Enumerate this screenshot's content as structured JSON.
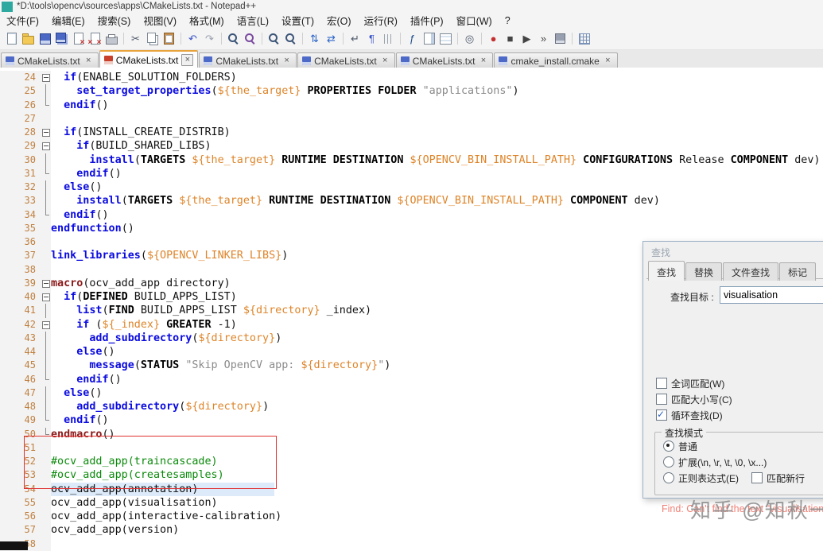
{
  "window": {
    "title": "*D:\\tools\\opencv\\sources\\apps\\CMakeLists.txt - Notepad++"
  },
  "menu": {
    "items": [
      "文件(F)",
      "编辑(E)",
      "搜索(S)",
      "视图(V)",
      "格式(M)",
      "语言(L)",
      "设置(T)",
      "宏(O)",
      "运行(R)",
      "插件(P)",
      "窗口(W)",
      "?"
    ]
  },
  "toolbar": {
    "icons": [
      {
        "n": "new-file-icon",
        "s": "page"
      },
      {
        "n": "open-file-icon",
        "s": "folder"
      },
      {
        "n": "save-icon",
        "s": "floppy"
      },
      {
        "n": "save-all-icon",
        "s": "floppy2"
      },
      {
        "n": "close-icon",
        "s": "pagex"
      },
      {
        "n": "close-all-icon",
        "s": "pagexx"
      },
      {
        "n": "print-icon",
        "s": "printer"
      },
      {
        "sep": true
      },
      {
        "n": "cut-icon",
        "s": "glyph",
        "g": "✂",
        "c": "#4A5568"
      },
      {
        "n": "copy-icon",
        "s": "pages"
      },
      {
        "n": "paste-icon",
        "s": "clipboard"
      },
      {
        "sep": true
      },
      {
        "n": "undo-icon",
        "s": "glyph",
        "g": "↶",
        "c": "#3C55C8"
      },
      {
        "n": "redo-icon",
        "s": "glyph",
        "g": "↷",
        "c": "#9AA2B0"
      },
      {
        "sep": true
      },
      {
        "n": "find-icon",
        "s": "mag"
      },
      {
        "n": "replace-icon",
        "s": "magr"
      },
      {
        "sep": true
      },
      {
        "n": "zoom-in-icon",
        "s": "mag"
      },
      {
        "n": "zoom-out-icon",
        "s": "mag"
      },
      {
        "sep": true
      },
      {
        "n": "sync-vertical-icon",
        "s": "glyph",
        "g": "⇅",
        "c": "#2A63C8"
      },
      {
        "n": "sync-horizontal-icon",
        "s": "glyph",
        "g": "⇄",
        "c": "#2A63C8"
      },
      {
        "sep": true
      },
      {
        "n": "word-wrap-icon",
        "s": "glyph",
        "g": "↵",
        "c": "#4A5568"
      },
      {
        "n": "show-all-characters-icon",
        "s": "glyph",
        "g": "¶",
        "c": "#3C55C8"
      },
      {
        "n": "indent-guide-icon",
        "s": "indent"
      },
      {
        "sep": true
      },
      {
        "n": "function-list-icon",
        "s": "glyph",
        "g": "ƒ",
        "c": "#20508C"
      },
      {
        "n": "document-map-icon",
        "s": "map"
      },
      {
        "n": "document-switcher-icon",
        "s": "switch"
      },
      {
        "sep": true
      },
      {
        "n": "file-monitoring-icon",
        "s": "glyph",
        "g": "◎",
        "c": "#4A5568"
      },
      {
        "sep": true
      },
      {
        "n": "macro-record-icon",
        "s": "glyph",
        "g": "●",
        "c": "#C43030"
      },
      {
        "n": "macro-stop-icon",
        "s": "glyph",
        "g": "■",
        "c": "#444444"
      },
      {
        "n": "macro-play-icon",
        "s": "glyph",
        "g": "▶",
        "c": "#444444"
      },
      {
        "n": "macro-run-multiple-icon",
        "s": "glyph",
        "g": "»",
        "c": "#444444"
      },
      {
        "n": "macro-save-icon",
        "s": "floppyg"
      },
      {
        "sep": true
      },
      {
        "n": "plugin-grid-icon",
        "s": "grid"
      }
    ]
  },
  "tabs": [
    {
      "label": "CMakeLists.txt",
      "modified": false,
      "active": false
    },
    {
      "label": "CMakeLists.txt",
      "modified": true,
      "active": true
    },
    {
      "label": "CMakeLists.txt",
      "modified": false,
      "active": false
    },
    {
      "label": "CMakeLists.txt",
      "modified": false,
      "active": false
    },
    {
      "label": "CMakeLists.txt",
      "modified": false,
      "active": false
    },
    {
      "label": "cmake_install.cmake",
      "modified": false,
      "active": false
    }
  ],
  "editor": {
    "first_line": 24,
    "lines": [
      {
        "n": 24,
        "f": "box",
        "s": [
          [
            "  ",
            "pl"
          ],
          [
            "if",
            "kw"
          ],
          [
            "(ENABLE_SOLUTION_FOLDERS)",
            "pl"
          ]
        ]
      },
      {
        "n": 25,
        "f": "v",
        "s": [
          [
            "    ",
            "pl"
          ],
          [
            "set_target_properties",
            "kw"
          ],
          [
            "(",
            "pl"
          ],
          [
            "${the_target}",
            "var"
          ],
          [
            " ",
            "pl"
          ],
          [
            "PROPERTIES",
            "wd"
          ],
          [
            " ",
            "pl"
          ],
          [
            "FOLDER",
            "wd"
          ],
          [
            " ",
            "pl"
          ],
          [
            "\"applications\"",
            "str"
          ],
          [
            ")",
            "pl"
          ]
        ]
      },
      {
        "n": 26,
        "f": "end",
        "s": [
          [
            "  ",
            "pl"
          ],
          [
            "endif",
            "kw"
          ],
          [
            "()",
            "pl"
          ]
        ]
      },
      {
        "n": 27,
        "f": "",
        "s": []
      },
      {
        "n": 28,
        "f": "box",
        "s": [
          [
            "  ",
            "pl"
          ],
          [
            "if",
            "kw"
          ],
          [
            "(INSTALL_CREATE_DISTRIB)",
            "pl"
          ]
        ]
      },
      {
        "n": 29,
        "f": "box",
        "s": [
          [
            "    ",
            "pl"
          ],
          [
            "if",
            "kw"
          ],
          [
            "(BUILD_SHARED_LIBS)",
            "pl"
          ]
        ]
      },
      {
        "n": 30,
        "f": "v",
        "s": [
          [
            "      ",
            "pl"
          ],
          [
            "install",
            "kw"
          ],
          [
            "(",
            "pl"
          ],
          [
            "TARGETS",
            "wd"
          ],
          [
            " ",
            "pl"
          ],
          [
            "${the_target}",
            "var"
          ],
          [
            " ",
            "pl"
          ],
          [
            "RUNTIME",
            "wd"
          ],
          [
            " ",
            "pl"
          ],
          [
            "DESTINATION",
            "wd"
          ],
          [
            " ",
            "pl"
          ],
          [
            "${OPENCV_BIN_INSTALL_PATH}",
            "var"
          ],
          [
            " ",
            "pl"
          ],
          [
            "CONFIGURATIONS",
            "wd"
          ],
          [
            " Release ",
            "pl"
          ],
          [
            "COMPONENT",
            "wd"
          ],
          [
            " dev)",
            "pl"
          ]
        ]
      },
      {
        "n": 31,
        "f": "end",
        "s": [
          [
            "    ",
            "pl"
          ],
          [
            "endif",
            "kw"
          ],
          [
            "()",
            "pl"
          ]
        ]
      },
      {
        "n": 32,
        "f": "v",
        "s": [
          [
            "  ",
            "pl"
          ],
          [
            "else",
            "kw"
          ],
          [
            "()",
            "pl"
          ]
        ]
      },
      {
        "n": 33,
        "f": "v",
        "s": [
          [
            "    ",
            "pl"
          ],
          [
            "install",
            "kw"
          ],
          [
            "(",
            "pl"
          ],
          [
            "TARGETS",
            "wd"
          ],
          [
            " ",
            "pl"
          ],
          [
            "${the_target}",
            "var"
          ],
          [
            " ",
            "pl"
          ],
          [
            "RUNTIME",
            "wd"
          ],
          [
            " ",
            "pl"
          ],
          [
            "DESTINATION",
            "wd"
          ],
          [
            " ",
            "pl"
          ],
          [
            "${OPENCV_BIN_INSTALL_PATH}",
            "var"
          ],
          [
            " ",
            "pl"
          ],
          [
            "COMPONENT",
            "wd"
          ],
          [
            " dev)",
            "pl"
          ]
        ]
      },
      {
        "n": 34,
        "f": "end",
        "s": [
          [
            "  ",
            "pl"
          ],
          [
            "endif",
            "kw"
          ],
          [
            "()",
            "pl"
          ]
        ]
      },
      {
        "n": 35,
        "f": "",
        "s": [
          [
            "endfunction",
            "kw"
          ],
          [
            "()",
            "pl"
          ]
        ]
      },
      {
        "n": 36,
        "f": "",
        "s": []
      },
      {
        "n": 37,
        "f": "",
        "s": [
          [
            "link_libraries",
            "kw"
          ],
          [
            "(",
            "pl"
          ],
          [
            "${OPENCV_LINKER_LIBS}",
            "var"
          ],
          [
            ")",
            "pl"
          ]
        ]
      },
      {
        "n": 38,
        "f": "",
        "s": []
      },
      {
        "n": 39,
        "f": "box",
        "s": [
          [
            "macro",
            "mc"
          ],
          [
            "(ocv_add_app directory)",
            "pl"
          ]
        ]
      },
      {
        "n": 40,
        "f": "box",
        "s": [
          [
            "  ",
            "pl"
          ],
          [
            "if",
            "kw"
          ],
          [
            "(",
            "pl"
          ],
          [
            "DEFINED",
            "wd"
          ],
          [
            " BUILD_APPS_LIST)",
            "pl"
          ]
        ]
      },
      {
        "n": 41,
        "f": "v",
        "s": [
          [
            "    ",
            "pl"
          ],
          [
            "list",
            "kw"
          ],
          [
            "(",
            "pl"
          ],
          [
            "FIND",
            "wd"
          ],
          [
            " BUILD_APPS_LIST ",
            "pl"
          ],
          [
            "${directory}",
            "var"
          ],
          [
            " _index)",
            "pl"
          ]
        ]
      },
      {
        "n": 42,
        "f": "box",
        "s": [
          [
            "    ",
            "pl"
          ],
          [
            "if",
            "kw"
          ],
          [
            " (",
            "pl"
          ],
          [
            "${_index}",
            "var"
          ],
          [
            " ",
            "pl"
          ],
          [
            "GREATER",
            "wd"
          ],
          [
            " -1)",
            "pl"
          ]
        ]
      },
      {
        "n": 43,
        "f": "v",
        "s": [
          [
            "      ",
            "pl"
          ],
          [
            "add_subdirectory",
            "kw"
          ],
          [
            "(",
            "pl"
          ],
          [
            "${directory}",
            "var"
          ],
          [
            ")",
            "pl"
          ]
        ]
      },
      {
        "n": 44,
        "f": "v",
        "s": [
          [
            "    ",
            "pl"
          ],
          [
            "else",
            "kw"
          ],
          [
            "()",
            "pl"
          ]
        ]
      },
      {
        "n": 45,
        "f": "v",
        "s": [
          [
            "      ",
            "pl"
          ],
          [
            "message",
            "kw"
          ],
          [
            "(",
            "pl"
          ],
          [
            "STATUS",
            "wd"
          ],
          [
            " ",
            "pl"
          ],
          [
            "\"Skip OpenCV app: ",
            "str"
          ],
          [
            "${directory}",
            "var"
          ],
          [
            "\"",
            "str"
          ],
          [
            ")",
            "pl"
          ]
        ]
      },
      {
        "n": 46,
        "f": "end",
        "s": [
          [
            "    ",
            "pl"
          ],
          [
            "endif",
            "kw"
          ],
          [
            "()",
            "pl"
          ]
        ]
      },
      {
        "n": 47,
        "f": "v",
        "s": [
          [
            "  ",
            "pl"
          ],
          [
            "else",
            "kw"
          ],
          [
            "()",
            "pl"
          ]
        ]
      },
      {
        "n": 48,
        "f": "v",
        "s": [
          [
            "    ",
            "pl"
          ],
          [
            "add_subdirectory",
            "kw"
          ],
          [
            "(",
            "pl"
          ],
          [
            "${directory}",
            "var"
          ],
          [
            ")",
            "pl"
          ]
        ]
      },
      {
        "n": 49,
        "f": "end",
        "s": [
          [
            "  ",
            "pl"
          ],
          [
            "endif",
            "kw"
          ],
          [
            "()",
            "pl"
          ]
        ]
      },
      {
        "n": 50,
        "f": "end",
        "s": [
          [
            "endmacro",
            "mc"
          ],
          [
            "()",
            "pl"
          ]
        ]
      },
      {
        "n": 51,
        "f": "",
        "s": []
      },
      {
        "n": 52,
        "f": "",
        "s": [
          [
            "#ocv_add_app(traincascade)",
            "cm"
          ]
        ]
      },
      {
        "n": 53,
        "f": "",
        "s": [
          [
            "#ocv_add_app(createsamples)",
            "cm"
          ]
        ]
      },
      {
        "n": 54,
        "f": "",
        "cur": true,
        "s": [
          [
            "ocv_add_app(annotation)",
            "pl"
          ]
        ]
      },
      {
        "n": 55,
        "f": "",
        "s": [
          [
            "ocv_add_app(visualisation)",
            "pl"
          ]
        ]
      },
      {
        "n": 56,
        "f": "",
        "s": [
          [
            "ocv_add_app(interactive-calibration)",
            "pl"
          ]
        ]
      },
      {
        "n": 57,
        "f": "",
        "s": [
          [
            "ocv_add_app(version)",
            "pl"
          ]
        ]
      },
      {
        "n": 58,
        "f": "",
        "s": []
      }
    ]
  },
  "find_dialog": {
    "title": "查找",
    "tabs": [
      {
        "label": "查找",
        "active": true
      },
      {
        "label": "替换",
        "active": false
      },
      {
        "label": "文件查找",
        "active": false
      },
      {
        "label": "标记",
        "active": false
      }
    ],
    "target_label": "查找目标 :",
    "target_value": "visualisation",
    "options": [
      {
        "label": "全词匹配(W)",
        "checked": false
      },
      {
        "label": "匹配大小写(C)",
        "checked": false
      },
      {
        "label": "循环查找(D)",
        "checked": true
      }
    ],
    "mode": {
      "label": "查找模式",
      "radios": [
        {
          "label": "普通",
          "selected": true
        },
        {
          "label": "扩展(\\n, \\r, \\t, \\0, \\x...)",
          "selected": false
        },
        {
          "label": "正则表达式(E)",
          "selected": false
        }
      ],
      "extra_checkbox": {
        "label": "匹配新行",
        "checked": false
      }
    }
  },
  "status_message": "Find: Can't find the text \"visualisation\"",
  "watermark": "知乎 @知秋一叶"
}
